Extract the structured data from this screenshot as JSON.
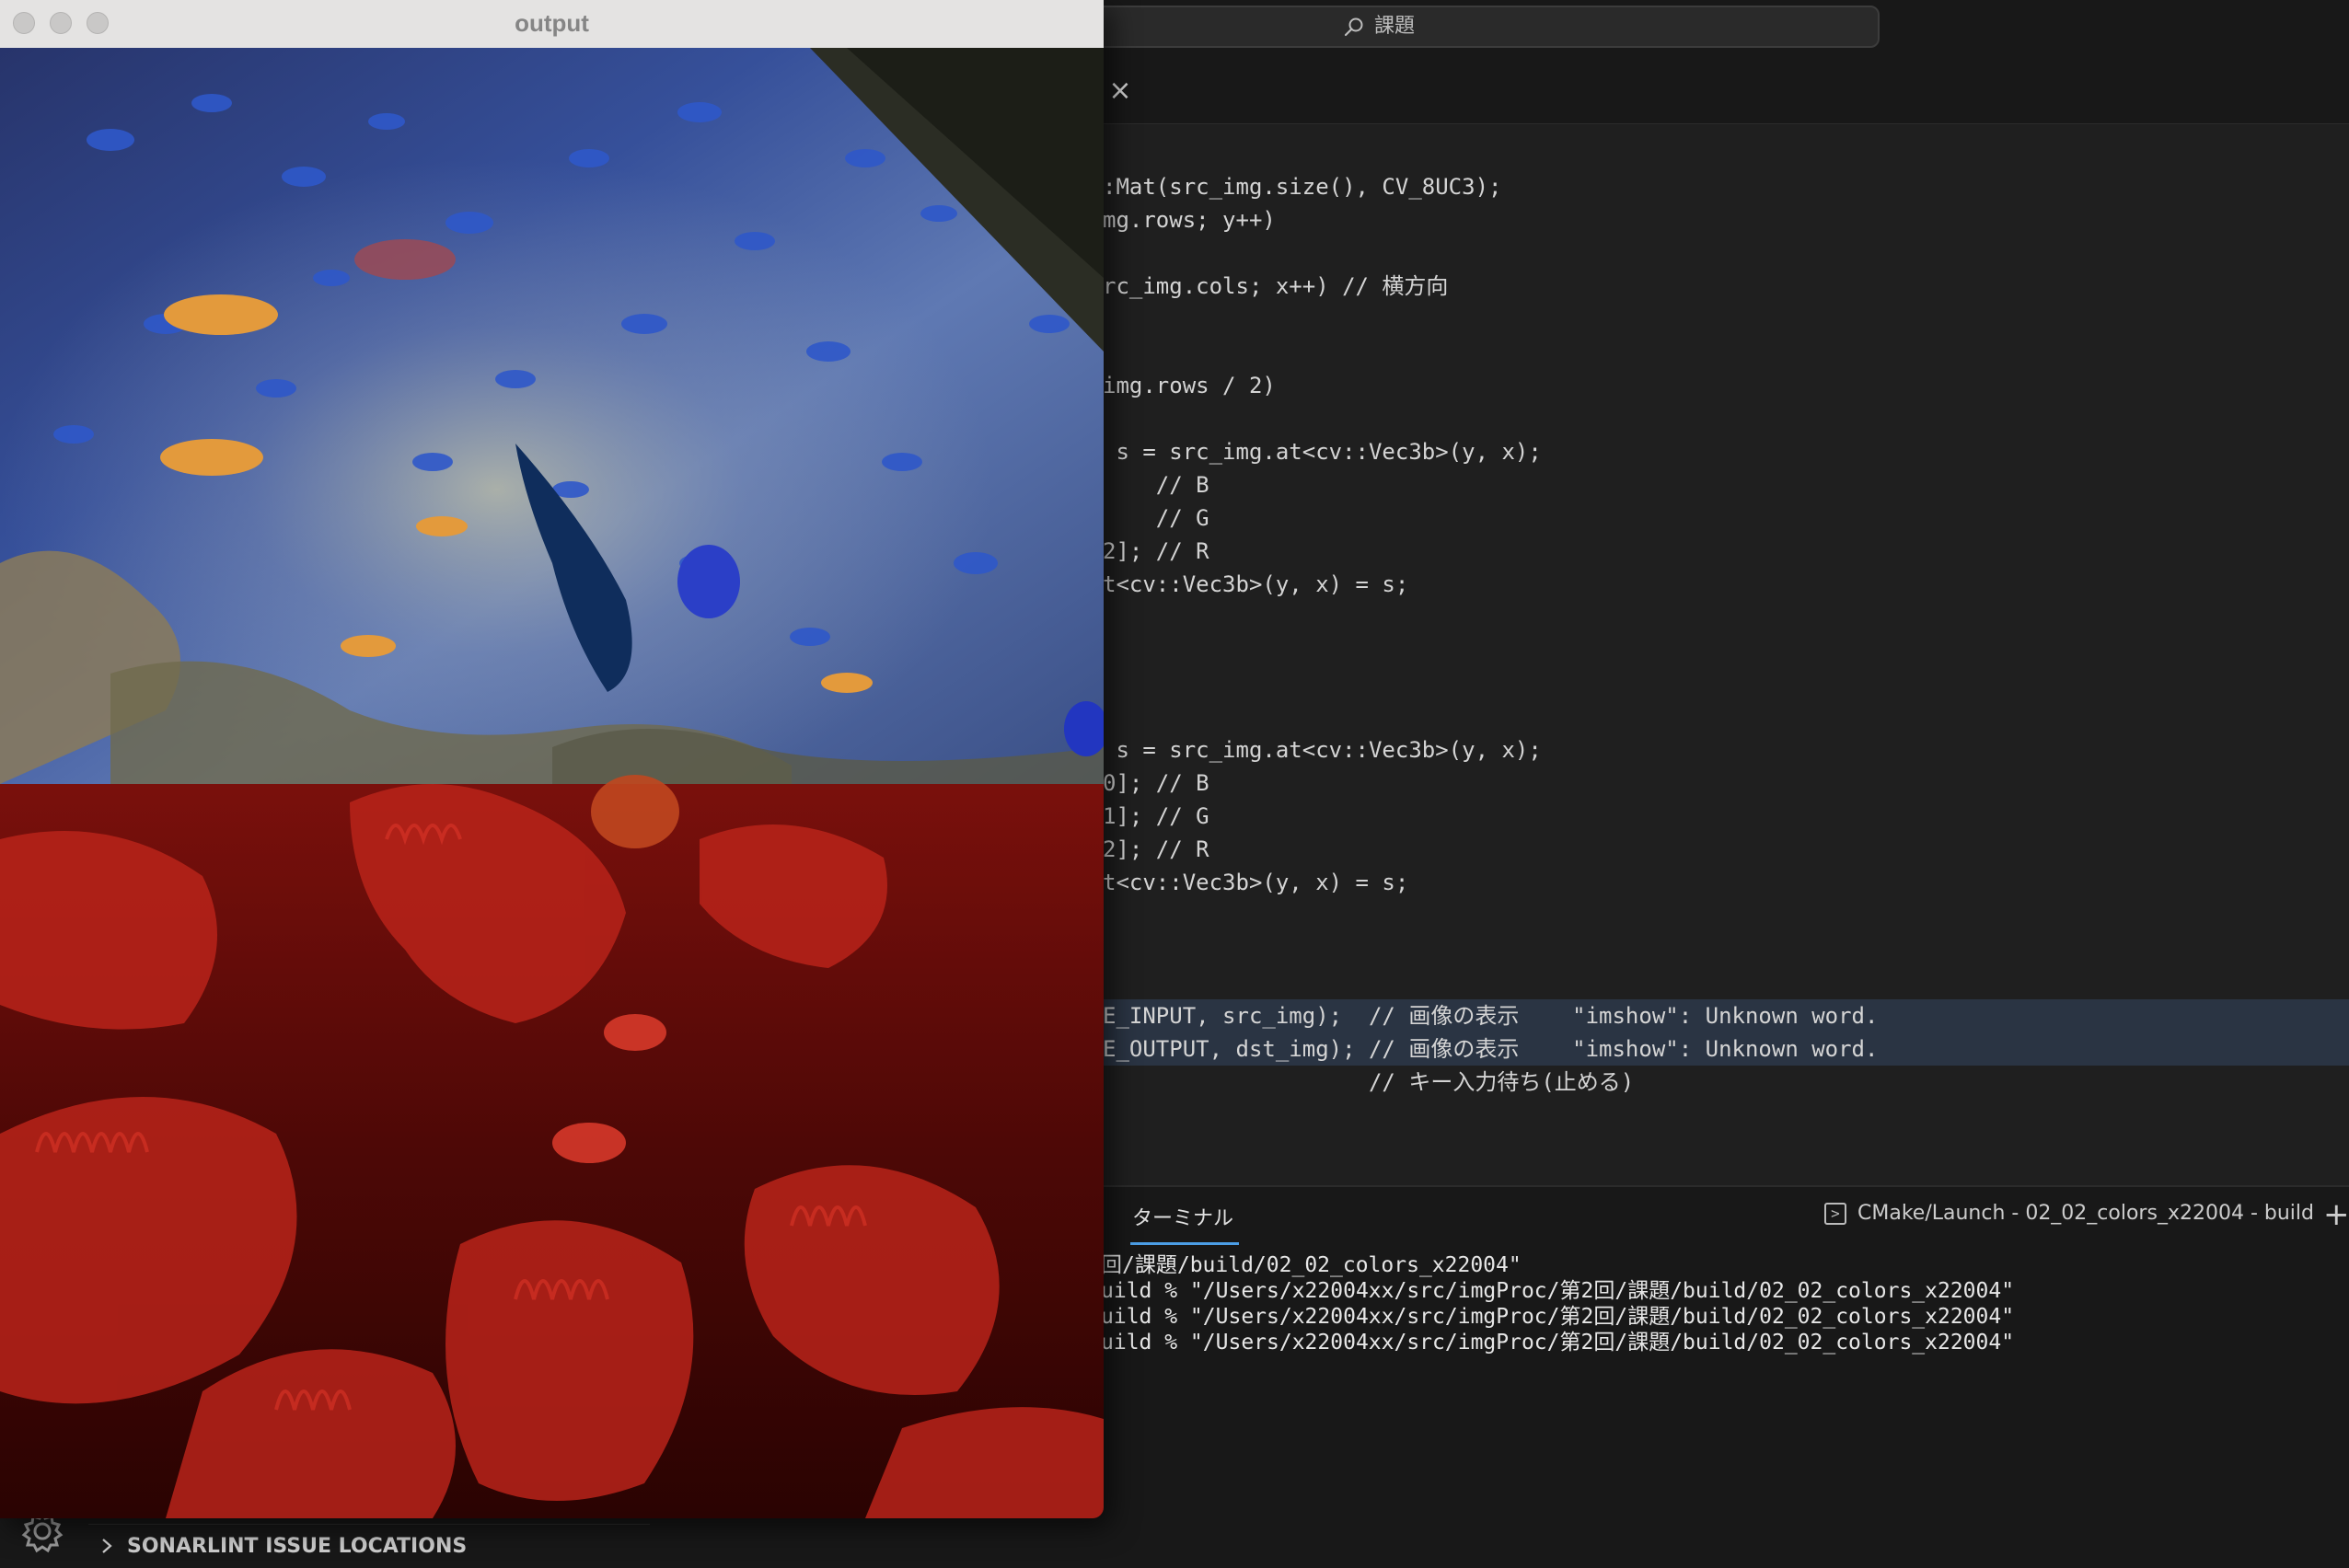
{
  "output_window": {
    "title": "output"
  },
  "vscode": {
    "search_placeholder": "課題",
    "code_lines": [
      ":Mat(src_img.size(), CV_8UC3);",
      "mg.rows; y++)",
      "rc_img.cols; x++) // 横方向",
      "img.rows / 2)",
      " s = src_img.at<cv::Vec3b>(y, x);",
      "    // B",
      "    // G",
      "2]; // R",
      "t<cv::Vec3b>(y, x) = s;",
      " s = src_img.at<cv::Vec3b>(y, x);",
      "0]; // B",
      "1]; // G",
      "2]; // R",
      "t<cv::Vec3b>(y, x) = s;",
      "E_INPUT, src_img);  // 画像の表示    \"imshow\": Unknown word.",
      "E_OUTPUT, dst_img); // 画像の表示    \"imshow\": Unknown word.",
      "                    // キー入力待ち(止める)"
    ],
    "panel": {
      "terminal_tab": "ターミナル",
      "launch_label": "CMake/Launch - 02_02_colors_x22004 - build",
      "terminal_lines": [
        "回/課題/build/02_02_colors_x22004\"",
        "uild % \"/Users/x22004xx/src/imgProc/第2回/課題/build/02_02_colors_x22004\"",
        "uild % \"/Users/x22004xx/src/imgProc/第2回/課題/build/02_02_colors_x22004\"",
        "uild % \"/Users/x22004xx/src/imgProc/第2回/課題/build/02_02_colors_x22004\""
      ]
    },
    "sonarlint_label": "SONARLINT ISSUE LOCATIONS"
  },
  "colors": {
    "accent": "#4c9ee6",
    "editor_bg": "#1f1f1f",
    "highlight_bg": "#2a3443"
  }
}
